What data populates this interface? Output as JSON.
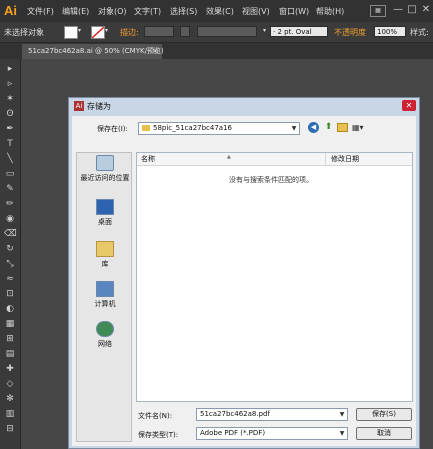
{
  "app": {
    "logo": "Ai"
  },
  "menu": [
    "文件(F)",
    "编辑(E)",
    "对象(O)",
    "文字(T)",
    "选择(S)",
    "效果(C)",
    "视图(V)",
    "窗口(W)",
    "帮助(H)"
  ],
  "window_controls": [
    "—",
    "□",
    "✕"
  ],
  "control_bar": {
    "selection_status": "未选择对象",
    "stroke_label": "描边:",
    "brush_value": "· 2 pt. Oval",
    "opacity_label": "不透明度",
    "opacity_value": "100%",
    "style_label": "样式:"
  },
  "document_tab": {
    "label": "51ca27bc462a8.ai @ 50% (CMYK/预览)",
    "close": "×"
  },
  "tools": [
    "selection-tool",
    "direct-selection-tool",
    "magic-wand-tool",
    "lasso-tool",
    "pen-tool",
    "type-tool",
    "line-tool",
    "rectangle-tool",
    "paintbrush-tool",
    "pencil-tool",
    "blob-brush-tool",
    "eraser-tool",
    "rotate-tool",
    "scale-tool",
    "warp-tool",
    "free-transform-tool",
    "shape-builder-tool",
    "perspective-grid-tool",
    "mesh-tool",
    "gradient-tool",
    "eyedropper-tool",
    "blend-tool",
    "symbol-sprayer-tool",
    "column-graph-tool",
    "artboard-tool"
  ],
  "tool_glyphs": [
    "▸",
    "▹",
    "✶",
    "ʘ",
    "✒",
    "T",
    "╲",
    "▭",
    "✎",
    "✏",
    "◉",
    "⌫",
    "↻",
    "⤡",
    "≈",
    "⊡",
    "◐",
    "▦",
    "⊞",
    "▤",
    "✚",
    "◇",
    "✻",
    "▥",
    "⊟"
  ],
  "dialog": {
    "title": "存储为",
    "icon": "Ai",
    "close": "✕",
    "save_in_label": "保存在(I):",
    "save_in_value": "58pic_51ca27bc47a16",
    "nav_icons": [
      "back-icon",
      "up-folder-icon",
      "new-folder-icon",
      "view-menu-icon"
    ],
    "places": [
      {
        "label": "最近访问的位置",
        "icon": "recent-places-icon"
      },
      {
        "label": "桌面",
        "icon": "desktop-icon"
      },
      {
        "label": "库",
        "icon": "libraries-icon"
      },
      {
        "label": "计算机",
        "icon": "computer-icon"
      },
      {
        "label": "网络",
        "icon": "network-icon"
      }
    ],
    "columns": [
      "名称",
      "修改日期"
    ],
    "empty_message": "没有与搜索条件匹配的项。",
    "filename_label": "文件名(N):",
    "filename_value": "51ca27bc462a8.pdf",
    "filetype_label": "保存类型(T):",
    "filetype_value": "Adobe PDF (*.PDF)",
    "save_button": "保存(S)",
    "cancel_button": "取消"
  }
}
